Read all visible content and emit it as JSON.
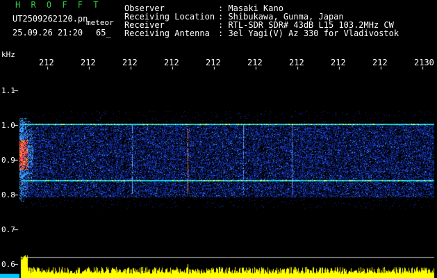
{
  "header": {
    "title": "H R O F F T",
    "filename": "UT2509262120.pn",
    "file_tag": "meteor",
    "datetime": "25.09.26 21:20",
    "count": "65_"
  },
  "info": {
    "labels": [
      "Observer",
      "Receiving Location",
      "Receiver",
      "Receiving Antenna"
    ],
    "values": [
      ": Masaki Kano",
      ": Shibukawa, Gunma, Japan",
      ": RTL-SDR SDR# 43dB L15 103.2MHz CW",
      ": 3el Yagi(V) Az 330 for Vladivostok"
    ]
  },
  "axis": {
    "unit": "kHz",
    "y_ticks": [
      "1.1",
      "1.0",
      "0.9",
      "0.8",
      "0.7",
      "0.6"
    ],
    "x_ticks": [
      "212",
      "212",
      "212",
      "212",
      "212",
      "212",
      "212",
      "212",
      "212",
      "2130"
    ]
  },
  "colors": {
    "background": "#000000",
    "text": "#ffffff",
    "title": "#2ecc40",
    "noise": "#1a3cff",
    "carrier": "#00e0ff",
    "bars": "#ffff00"
  }
}
